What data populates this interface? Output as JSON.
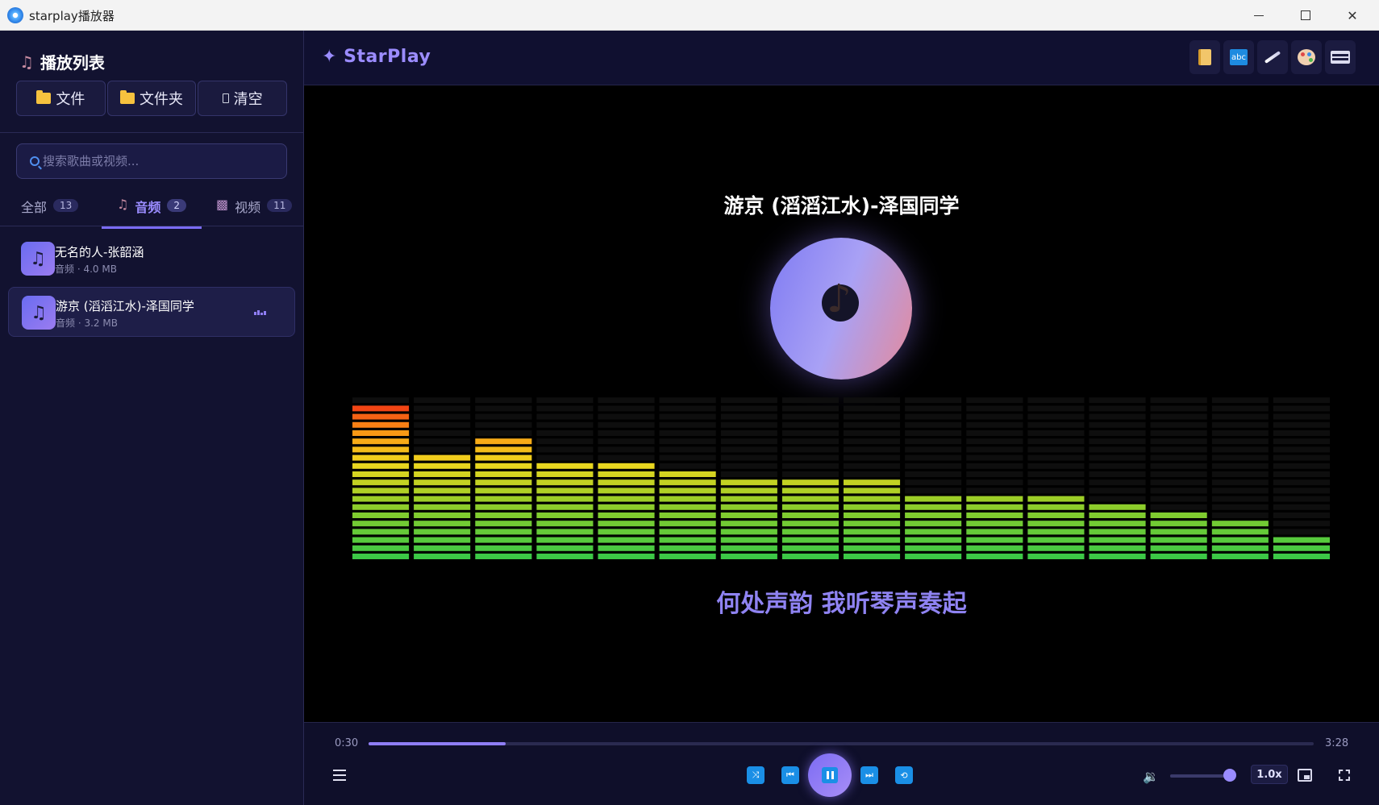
{
  "window": {
    "title": "starplay播放器"
  },
  "sidebar": {
    "header": "播放列表",
    "buttons": {
      "file": "文件",
      "folder": "文件夹",
      "clear": "清空"
    },
    "search_placeholder": "搜索歌曲或视频...",
    "tabs": [
      {
        "label": "全部",
        "count": "13"
      },
      {
        "label": "音频",
        "count": "2"
      },
      {
        "label": "视频",
        "count": "11"
      }
    ],
    "active_tab": "音频",
    "items": [
      {
        "name": "无名的人-张韶涵",
        "meta": "音频 · 4.0 MB",
        "active": false
      },
      {
        "name": "游京 (滔滔江水)-泽国同学",
        "meta": "音频 · 3.2 MB",
        "active": true
      }
    ]
  },
  "topbar": {
    "brand": "✦ StarPlay",
    "tools": [
      "scroll-icon",
      "abc-icon",
      "brush-icon",
      "palette-icon",
      "keyboard-icon"
    ]
  },
  "player": {
    "now_playing_title": "游京 (滔滔江水)-泽国同学",
    "lyric": "何处声韵 我听琴声奏起",
    "visualizer_levels": [
      19,
      13,
      15,
      12,
      12,
      11,
      10,
      10,
      10,
      8,
      8,
      8,
      7,
      6,
      5,
      3
    ],
    "visualizer_max_segments": 20
  },
  "controls": {
    "current_time": "0:30",
    "total_time": "3:28",
    "progress": 0.145,
    "volume": 0.88,
    "speed": "1.0x",
    "colors": {
      "accent": "#8f7ef5",
      "control_blue": "#1a8fe6"
    }
  }
}
